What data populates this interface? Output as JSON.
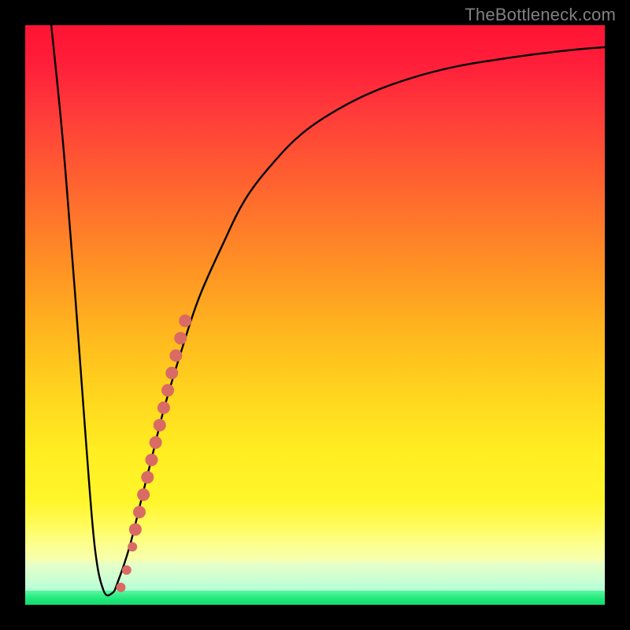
{
  "attribution": "TheBottleneck.com",
  "chart_data": {
    "type": "line",
    "title": "",
    "xlabel": "",
    "ylabel": "",
    "xlim": [
      0,
      100
    ],
    "ylim": [
      0,
      100
    ],
    "background_gradient": {
      "stops": [
        {
          "pos": 0.0,
          "color": "#ff1434"
        },
        {
          "pos": 0.4,
          "color": "#ff7a2a"
        },
        {
          "pos": 0.7,
          "color": "#ffd61e"
        },
        {
          "pos": 0.82,
          "color": "#fff62a"
        },
        {
          "pos": 0.9,
          "color": "#fcff8c"
        },
        {
          "pos": 0.95,
          "color": "#d2ffd0"
        },
        {
          "pos": 1.0,
          "color": "#14da6e"
        }
      ]
    },
    "series": [
      {
        "name": "bottleneck-curve",
        "color": "#000000",
        "x": [
          4.5,
          6.5,
          8.5,
          10.5,
          12.0,
          13.5,
          15.0,
          16.0,
          18.0,
          20.0,
          22.0,
          24.0,
          27.0,
          30.0,
          34.0,
          38.0,
          43.0,
          48.0,
          54.0,
          60.0,
          67.0,
          74.0,
          81.0,
          88.0,
          95.0,
          100.0
        ],
        "y": [
          100.0,
          80.0,
          55.0,
          28.0,
          10.0,
          2.5,
          2.0,
          4.0,
          10.0,
          18.0,
          26.0,
          34.0,
          44.0,
          53.0,
          62.0,
          70.0,
          76.5,
          81.5,
          85.5,
          88.5,
          91.0,
          92.8,
          94.0,
          95.0,
          95.8,
          96.2
        ]
      }
    ],
    "markers": {
      "name": "highlight-dots",
      "color": "#d96a64",
      "radius_main": 8,
      "radius_outlier": 6,
      "points": [
        {
          "x": 16.5,
          "y": 3.0,
          "r": 6
        },
        {
          "x": 17.5,
          "y": 6.0,
          "r": 6
        },
        {
          "x": 18.5,
          "y": 10.0,
          "r": 6
        },
        {
          "x": 19.0,
          "y": 13.0,
          "r": 8
        },
        {
          "x": 19.7,
          "y": 16.0,
          "r": 8
        },
        {
          "x": 20.4,
          "y": 19.0,
          "r": 8
        },
        {
          "x": 21.1,
          "y": 22.0,
          "r": 8
        },
        {
          "x": 21.8,
          "y": 25.0,
          "r": 8
        },
        {
          "x": 22.5,
          "y": 28.0,
          "r": 8
        },
        {
          "x": 23.2,
          "y": 31.0,
          "r": 8
        },
        {
          "x": 23.9,
          "y": 34.0,
          "r": 8
        },
        {
          "x": 24.6,
          "y": 37.0,
          "r": 8
        },
        {
          "x": 25.3,
          "y": 40.0,
          "r": 8
        },
        {
          "x": 26.0,
          "y": 43.0,
          "r": 8
        },
        {
          "x": 26.8,
          "y": 46.0,
          "r": 8
        },
        {
          "x": 27.6,
          "y": 49.0,
          "r": 8
        }
      ]
    }
  }
}
